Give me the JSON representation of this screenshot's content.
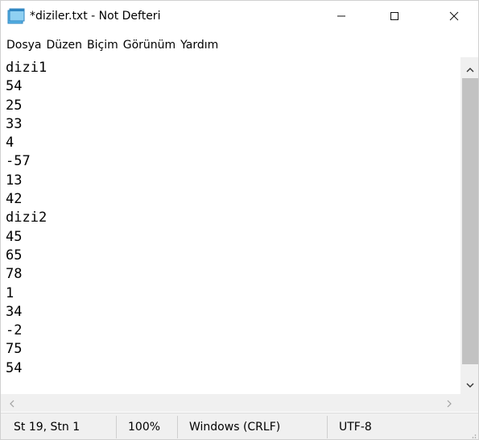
{
  "window": {
    "title": "*diziler.txt - Not Defteri",
    "icon": "notepad-icon",
    "controls": {
      "minimize": "minimize-icon",
      "maximize": "maximize-icon",
      "close": "close-icon"
    }
  },
  "menu": {
    "items": [
      {
        "label": "Dosya"
      },
      {
        "label": "Düzen"
      },
      {
        "label": "Biçim"
      },
      {
        "label": "Görünüm"
      },
      {
        "label": "Yardım"
      }
    ]
  },
  "editor": {
    "lines": [
      "dizi1",
      "54",
      "25",
      "33",
      "4",
      "-57",
      "13",
      "42",
      "dizi2",
      "45",
      "65",
      "78",
      "1",
      "34",
      "-2",
      "75",
      "54"
    ]
  },
  "statusbar": {
    "position": "St 19, Stn 1",
    "zoom": "100%",
    "line_ending": "Windows (CRLF)",
    "encoding": "UTF-8"
  },
  "colors": {
    "scrollbar_track": "#f0f0f0",
    "scrollbar_thumb": "#c2c2c2",
    "icon_blue": "#58b4e6"
  }
}
